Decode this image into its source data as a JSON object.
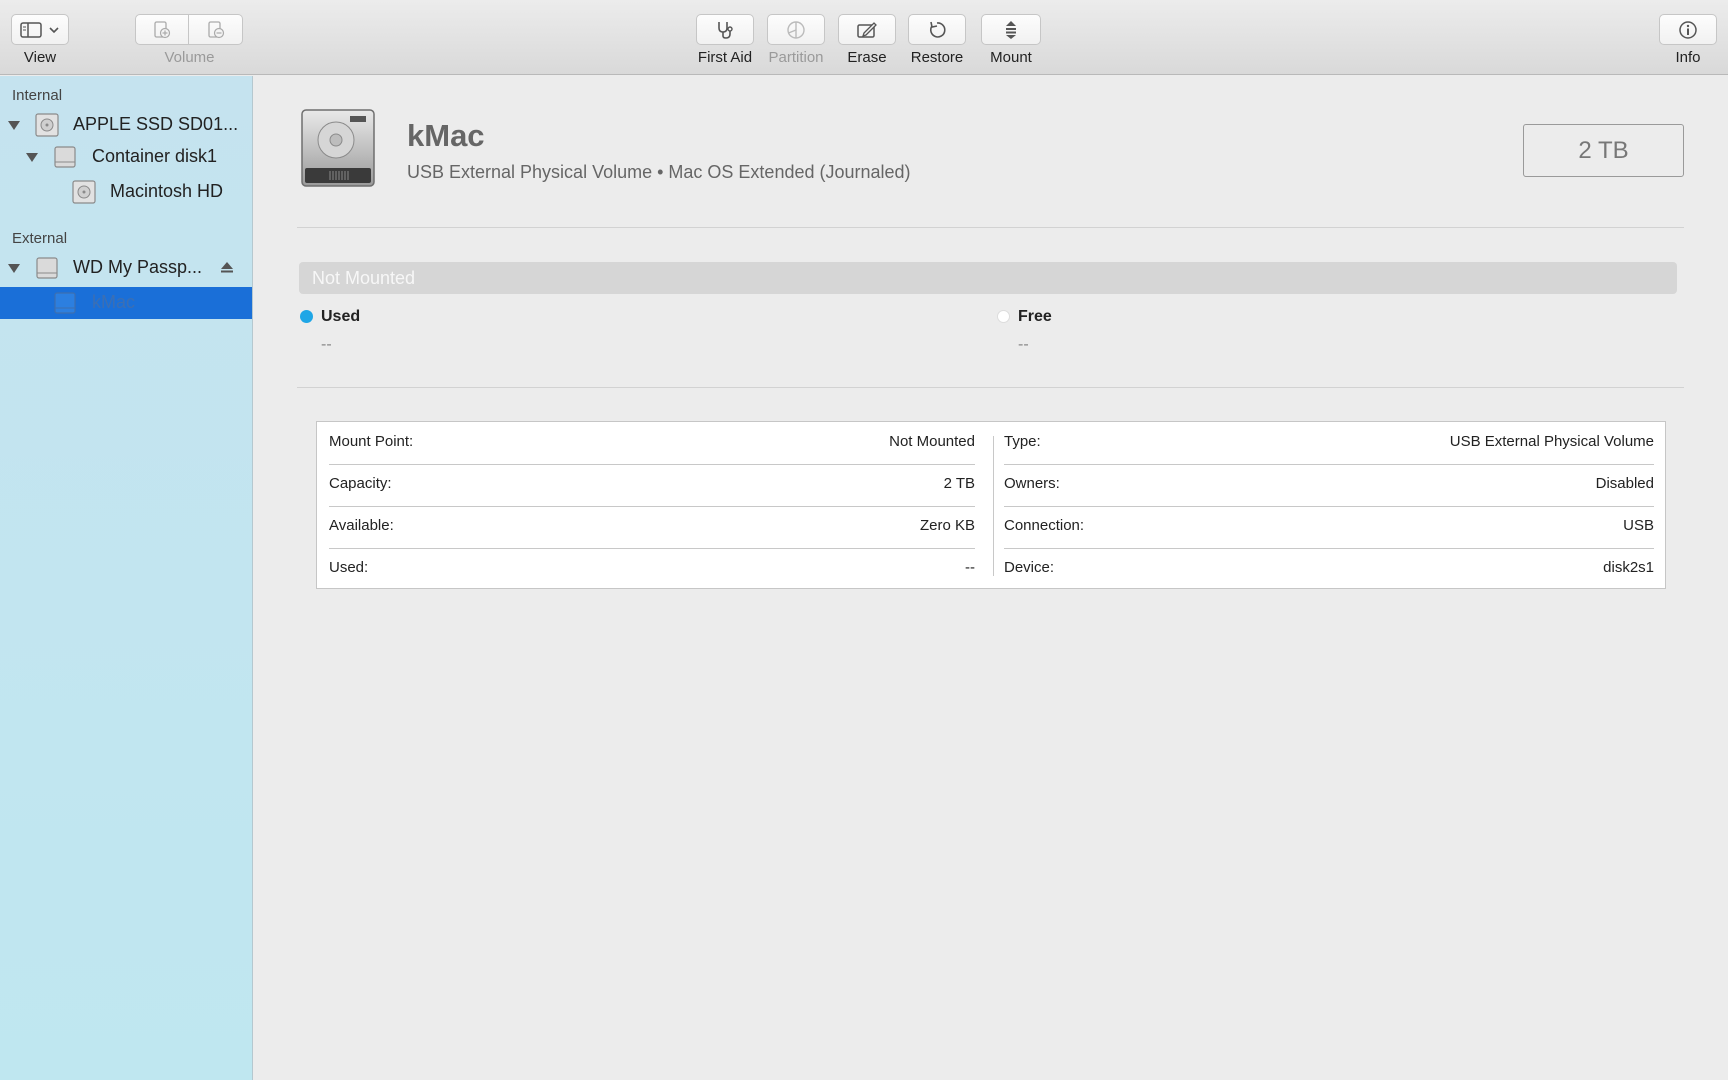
{
  "toolbar": {
    "view_label": "View",
    "volume_label": "Volume",
    "first_aid_label": "First Aid",
    "partition_label": "Partition",
    "erase_label": "Erase",
    "restore_label": "Restore",
    "mount_label": "Mount",
    "info_label": "Info"
  },
  "sidebar": {
    "internal_header": "Internal",
    "external_header": "External",
    "items": [
      {
        "label": "APPLE SSD SD01..."
      },
      {
        "label": "Container disk1"
      },
      {
        "label": "Macintosh HD"
      },
      {
        "label": "WD My Passp..."
      },
      {
        "label": "kMac"
      }
    ]
  },
  "volume": {
    "name": "kMac",
    "subtitle": "USB External Physical Volume • Mac OS Extended (Journaled)",
    "size": "2 TB"
  },
  "usage": {
    "bar_text": "Not Mounted",
    "used_label": "Used",
    "used_value": "--",
    "free_label": "Free",
    "free_value": "--",
    "used_color": "#1fa6e6",
    "free_color": "#ffffff"
  },
  "info": {
    "left": [
      {
        "key": "Mount Point:",
        "value": "Not Mounted"
      },
      {
        "key": "Capacity:",
        "value": "2 TB"
      },
      {
        "key": "Available:",
        "value": "Zero KB"
      },
      {
        "key": "Used:",
        "value": "--"
      }
    ],
    "right": [
      {
        "key": "Type:",
        "value": "USB External Physical Volume"
      },
      {
        "key": "Owners:",
        "value": "Disabled"
      },
      {
        "key": "Connection:",
        "value": "USB"
      },
      {
        "key": "Device:",
        "value": "disk2s1"
      }
    ]
  },
  "colors": {
    "selection": "#1a6fd8",
    "sidebar_bg": "#c5e3ef"
  }
}
